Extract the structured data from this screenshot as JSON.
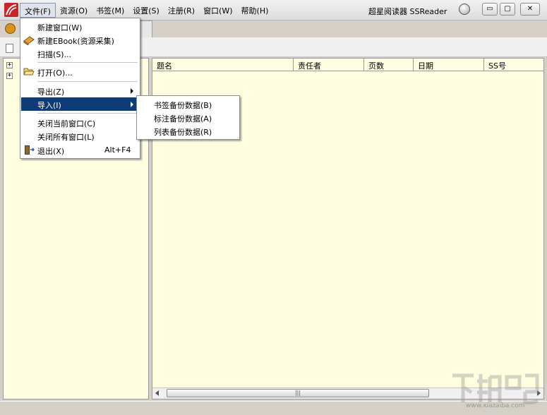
{
  "menubar": {
    "items": [
      {
        "label": "文件(F)"
      },
      {
        "label": "资源(O)"
      },
      {
        "label": "书签(M)"
      },
      {
        "label": "设置(S)"
      },
      {
        "label": "注册(R)"
      },
      {
        "label": "窗口(W)"
      },
      {
        "label": "帮助(H)"
      }
    ]
  },
  "window": {
    "title": "超星阅读器 SSReader",
    "min_label": "▭",
    "max_label": "▢",
    "close_label": "✕"
  },
  "list": {
    "columns": [
      "题名",
      "责任者",
      "页数",
      "日期",
      "SS号"
    ],
    "scroll_grip": "|||"
  },
  "tree": {
    "expander": "+"
  },
  "file_menu": {
    "new_window": "新建窗口(W)",
    "new_ebook": "新建EBook(资源采集)",
    "scan": "扫描(S)...",
    "open": "打开(O)...",
    "export": "导出(Z)",
    "import": "导入(I)",
    "close_current": "关闭当前窗口(C)",
    "close_all": "关闭所有窗口(L)",
    "exit": "退出(X)",
    "exit_shortcut": "Alt+F4"
  },
  "import_submenu": {
    "items": [
      "书签备份数据(B)",
      "标注备份数据(A)",
      "列表备份数据(R)"
    ]
  },
  "watermark": {
    "text": "www.xiazaiba.com"
  },
  "colors": {
    "menu_highlight": "#0f3b76",
    "pane_background": "#fffde0",
    "logo_red": "#c8242a"
  }
}
